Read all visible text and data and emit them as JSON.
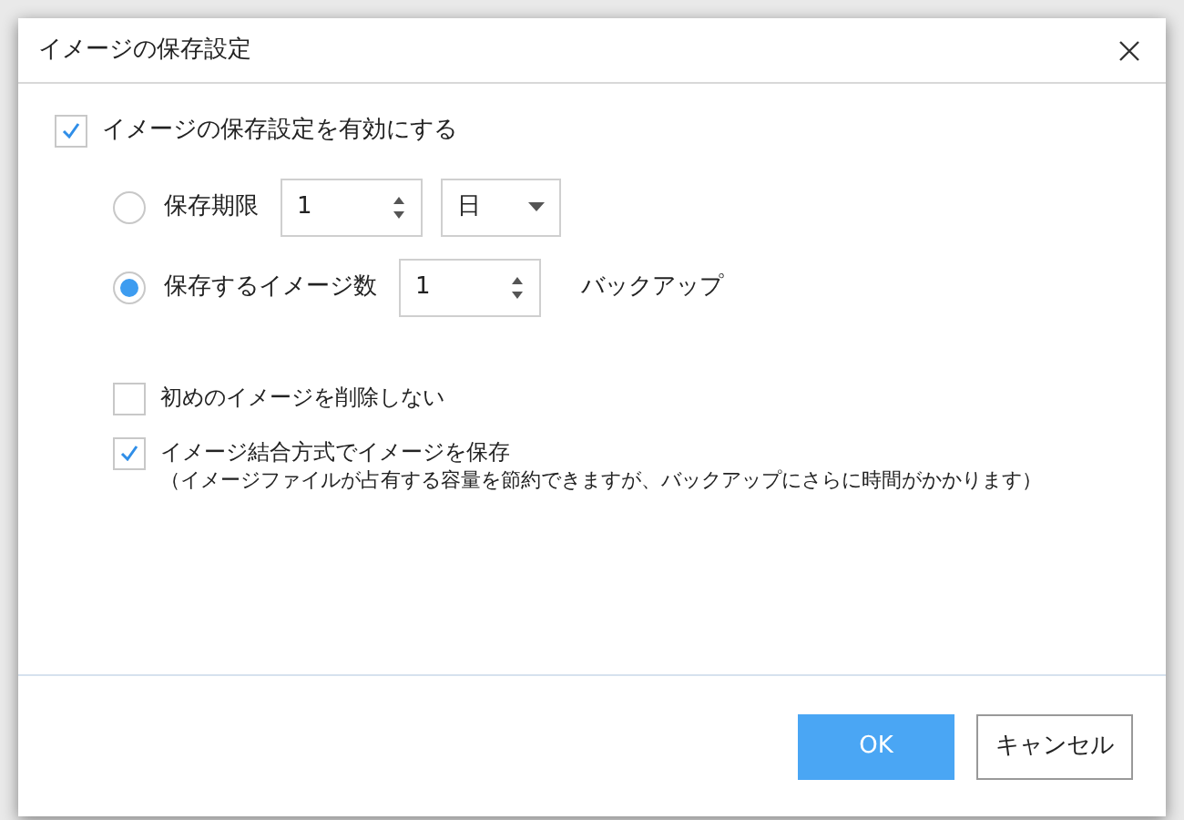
{
  "dialog": {
    "title": "イメージの保存設定"
  },
  "enable": {
    "label": "イメージの保存設定を有効にする",
    "checked": true
  },
  "retention": [
    {
      "kind": "period",
      "label": "保存期限",
      "selected": false,
      "value": "1",
      "unit": "日"
    },
    {
      "kind": "count",
      "label": "保存するイメージ数",
      "selected": true,
      "value": "1",
      "suffix": "バックアップ"
    }
  ],
  "options": [
    {
      "label": "初めのイメージを削除しない",
      "checked": false
    },
    {
      "label": "イメージ結合方式でイメージを保存",
      "note": "（イメージファイルが占有する容量を節約できますが、バックアップにさらに時間がかかります）",
      "checked": true
    }
  ],
  "buttons": [
    {
      "label": "OK",
      "kind": "primary"
    },
    {
      "label": "キャンセル",
      "kind": "secondary"
    }
  ]
}
